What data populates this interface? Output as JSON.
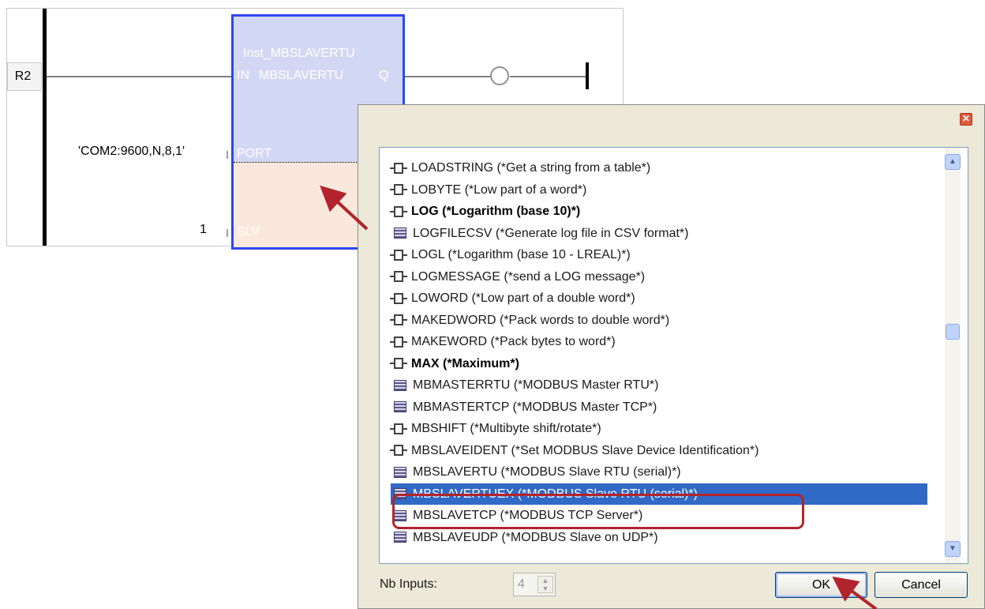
{
  "ladder": {
    "rung_label": "R2",
    "block": {
      "instance": "Inst_MBSLAVERTU",
      "name": "MBSLAVERTU",
      "in_pin": "IN",
      "out_pin": "Q",
      "port_pin": "PORT",
      "slv_pin": "SLV"
    },
    "port_value": "'COM2:9600,N,8,1'",
    "slv_value": "1"
  },
  "dialog": {
    "close_label": "✕",
    "items": [
      {
        "label": "LOADSTRING (*Get a string from a table*)",
        "icon": "function-icon"
      },
      {
        "label": "LOBYTE (*Low part of a word*)",
        "icon": "function-icon"
      },
      {
        "label": "LOG (*Logarithm (base 10)*)",
        "icon": "function-icon",
        "bold": true
      },
      {
        "label": "LOGFILECSV (*Generate log file in CSV format*)",
        "icon": "function-block-icon"
      },
      {
        "label": "LOGL (*Logarithm (base 10 - LREAL)*)",
        "icon": "function-icon"
      },
      {
        "label": "LOGMESSAGE (*send a LOG message*)",
        "icon": "function-icon"
      },
      {
        "label": "LOWORD (*Low part of a double word*)",
        "icon": "function-icon"
      },
      {
        "label": "MAKEDWORD (*Pack words to double word*)",
        "icon": "function-icon"
      },
      {
        "label": "MAKEWORD (*Pack bytes to word*)",
        "icon": "function-icon"
      },
      {
        "label": "MAX (*Maximum*)",
        "icon": "function-icon",
        "bold": true
      },
      {
        "label": "MBMASTERRTU (*MODBUS Master RTU*)",
        "icon": "function-block-icon"
      },
      {
        "label": "MBMASTERTCP (*MODBUS Master TCP*)",
        "icon": "function-block-icon"
      },
      {
        "label": "MBSHIFT (*Multibyte shift/rotate*)",
        "icon": "function-icon"
      },
      {
        "label": "MBSLAVEIDENT (*Set MODBUS Slave Device Identification*)",
        "icon": "function-icon"
      },
      {
        "label": "MBSLAVERTU (*MODBUS Slave RTU (serial)*)",
        "icon": "function-block-icon"
      },
      {
        "label": "MBSLAVERTUEX (*MODBUS Slave RTU (serial)*)",
        "icon": "function-block-icon",
        "selected": true
      },
      {
        "label": "MBSLAVETCP (*MODBUS TCP Server*)",
        "icon": "function-block-icon"
      },
      {
        "label": "MBSLAVEUDP (*MODBUS Slave on UDP*)",
        "icon": "function-block-icon"
      }
    ],
    "nb_inputs_label": "Nb Inputs:",
    "nb_inputs_value": "4",
    "ok_label": "OK",
    "cancel_label": "Cancel"
  },
  "colors": {
    "block_border": "#2e46f0",
    "block_fill": "#d2d8f4",
    "selection": "#3169c6",
    "annotation": "#b2242b"
  }
}
